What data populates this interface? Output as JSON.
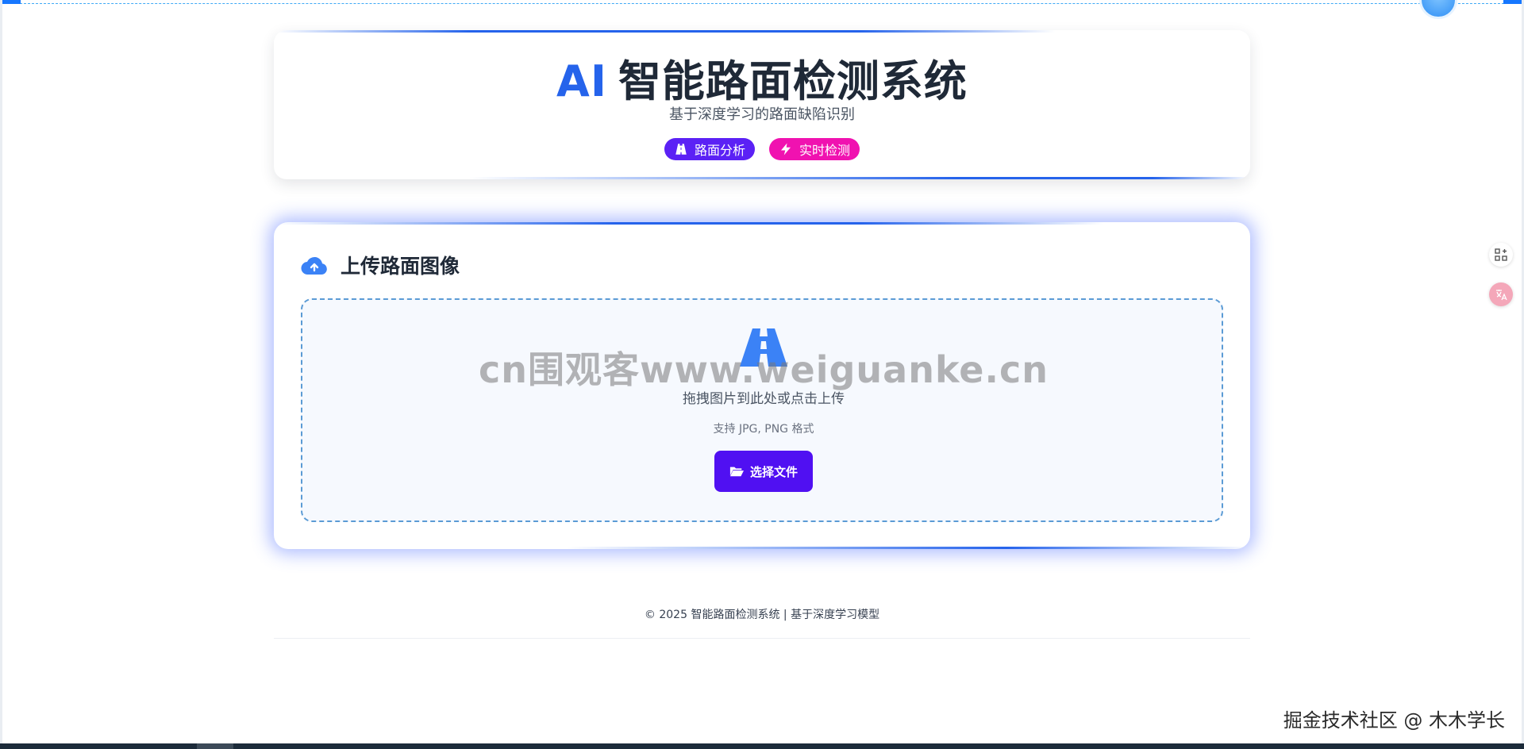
{
  "header": {
    "title_prefix": "AI",
    "title_main": "智能路面检测系统",
    "subtitle": "基于深度学习的路面缺陷识别",
    "badges": [
      {
        "label": "路面分析",
        "icon": "road-icon",
        "color": "#5b21f5"
      },
      {
        "label": "实时检测",
        "icon": "bolt-icon",
        "color": "#f012b0"
      }
    ]
  },
  "upload": {
    "section_title": "上传路面图像",
    "section_icon": "cloud-upload-icon",
    "dropzone_icon": "road-icon",
    "watermark": "cn围观客www.weiguanke.cn",
    "drop_text": "拖拽图片到此处或点击上传",
    "format_text": "支持 JPG, PNG 格式",
    "button_label": "选择文件",
    "button_icon": "folder-open-icon"
  },
  "footer": {
    "text": "© 2025 智能路面检测系统 | 基于深度学习模型"
  },
  "side_tools": [
    {
      "icon": "apps-add-icon"
    },
    {
      "icon": "translate-icon"
    }
  ],
  "corner_credit": "掘金技术社区 @ 木木学长",
  "colors": {
    "accent_blue": "#2563eb",
    "button_purple": "#5010f2",
    "badge_pink": "#f012b0"
  }
}
